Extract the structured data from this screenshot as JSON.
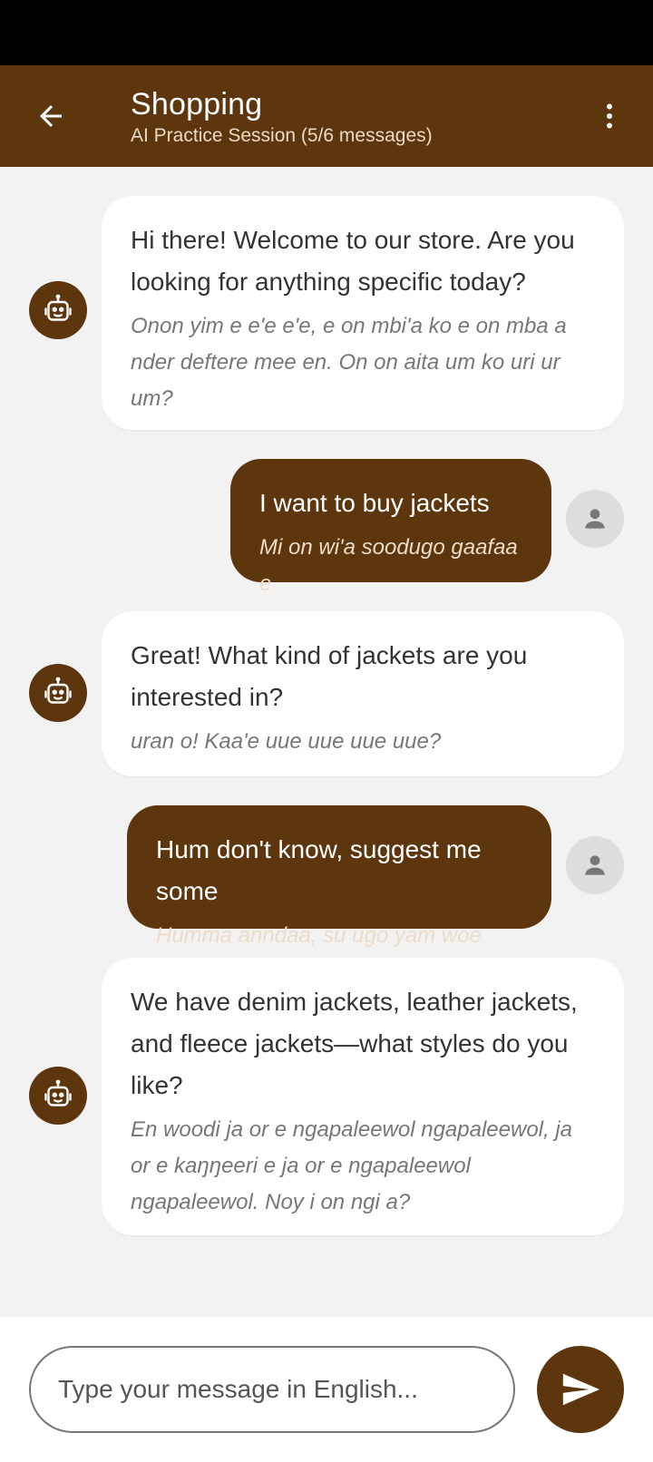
{
  "header": {
    "title": "Shopping",
    "subtitle": "AI Practice Session (5/6 messages)",
    "back_icon": "arrow-left-icon",
    "menu_icon": "more-vert-icon"
  },
  "colors": {
    "primary": "#5e360e",
    "background": "#f2f2f3",
    "bot_bubble": "#ffffff",
    "user_avatar_bg": "#dddddd"
  },
  "messages": [
    {
      "sender": "bot",
      "text": "Hi there! Welcome to our store. Are you looking for anything specific today?",
      "translation": "Onon yim e  e'e  e'e,  e  on mbi'a ko  e  on mba a nder deftere mee en. On  on  aita  um ko  uri   ur um?"
    },
    {
      "sender": "user",
      "text": "I want to buy jackets",
      "translation": "Mi  on wi'a soodugo gaafaa e"
    },
    {
      "sender": "bot",
      "text": "Great! What kind of jackets are you interested in?",
      "translation": " uran o! Kaa'e  uue  uue  uue  uue?"
    },
    {
      "sender": "user",
      "text": "Hum don't know, suggest me some",
      "translation": "Humma anndaa, su ugo yam woe"
    },
    {
      "sender": "bot",
      "text": "We have denim jackets, leather jackets, and fleece jackets—what styles do you like?",
      "translation": "En woodi ja or e ngapaleewol ngapaleewol, ja or e kaŋŋeeri e ja or e ngapaleewol ngapaleewol. Noy  i  on ngi a?"
    }
  ],
  "composer": {
    "placeholder": "Type your message in English...",
    "send_icon": "send-icon"
  }
}
